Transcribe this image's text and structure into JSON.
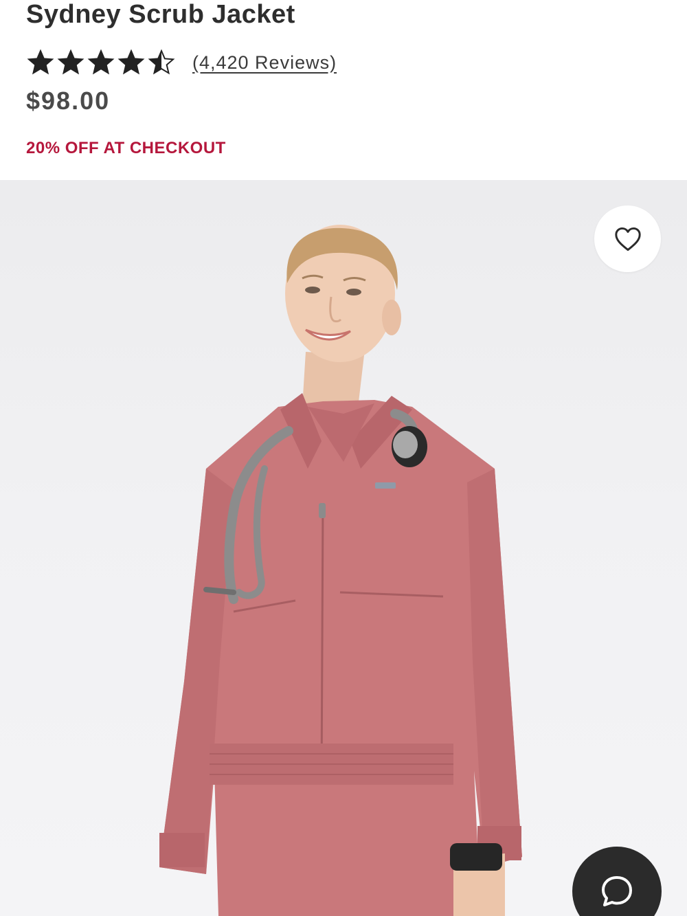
{
  "product": {
    "title": "Sydney Scrub Jacket",
    "rating": 4.5,
    "rating_max": 5,
    "reviews_label": "(4,420 Reviews)",
    "price": "$98.00",
    "promo": "20% OFF AT CHECKOUT"
  },
  "icons": {
    "favorite": "heart-outline-icon",
    "chat": "chat-bubble-icon",
    "rating": "star-icon"
  },
  "colors": {
    "promo": "#b5173c",
    "jacket": "#c9787b",
    "star": "#222222",
    "chat_button": "#2b2b2b"
  }
}
